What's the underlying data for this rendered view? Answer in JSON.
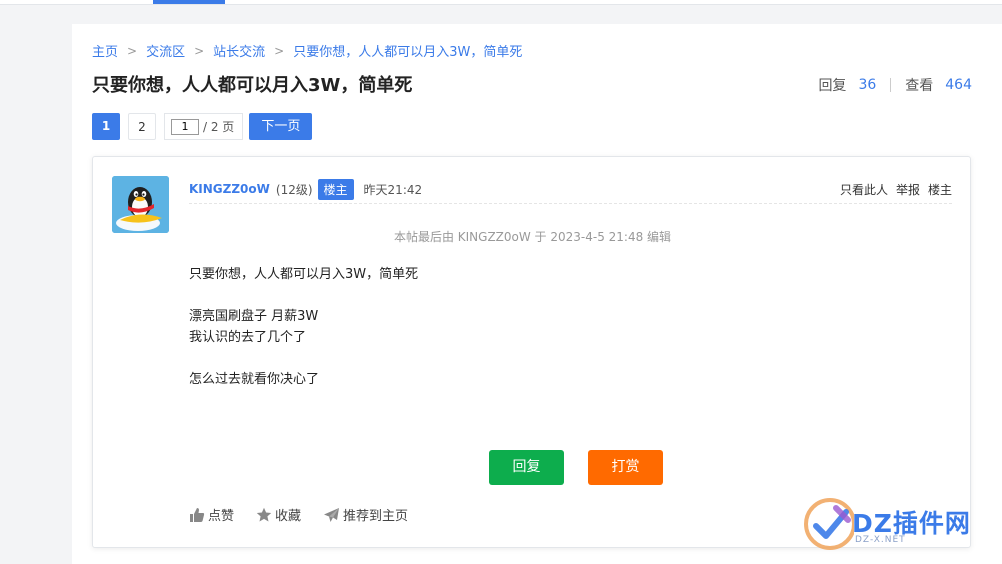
{
  "breadcrumb": [
    "主页",
    "交流区",
    "站长交流",
    "只要你想，人人都可以月入3W，简单死"
  ],
  "thread": {
    "title": "只要你想，人人都可以月入3W，简单死",
    "reply_label": "回复",
    "reply_count": "36",
    "view_label": "查看",
    "view_count": "464"
  },
  "pager": {
    "current": "1",
    "page2": "2",
    "input_value": "1",
    "total": "/ 2 页",
    "next_label": "下一页"
  },
  "post": {
    "author": "KINGZZ0oW",
    "level": "(12级)",
    "badge": "楼主",
    "time": "昨天21:42",
    "actions": [
      "只看此人",
      "举报",
      "楼主"
    ],
    "edit_note": "本帖最后由 KINGZZ0oW 于 2023-4-5 21:48 编辑",
    "lines": [
      "只要你想，人人都可以月入3W，简单死",
      "漂亮国刷盘子 月薪3W",
      "我认识的去了几个了",
      "怎么过去就看你决心了"
    ],
    "reply_button": "回复",
    "reward_button": "打赏",
    "tools": [
      "点赞",
      "收藏",
      "推荐到主页"
    ]
  },
  "watermark": {
    "text": "DZ插件网",
    "sub": "DZ-X.NET"
  },
  "colors": {
    "accent": "#3b7be8",
    "reply_button": "#0dad4d",
    "reward_button": "#ff6a00"
  }
}
